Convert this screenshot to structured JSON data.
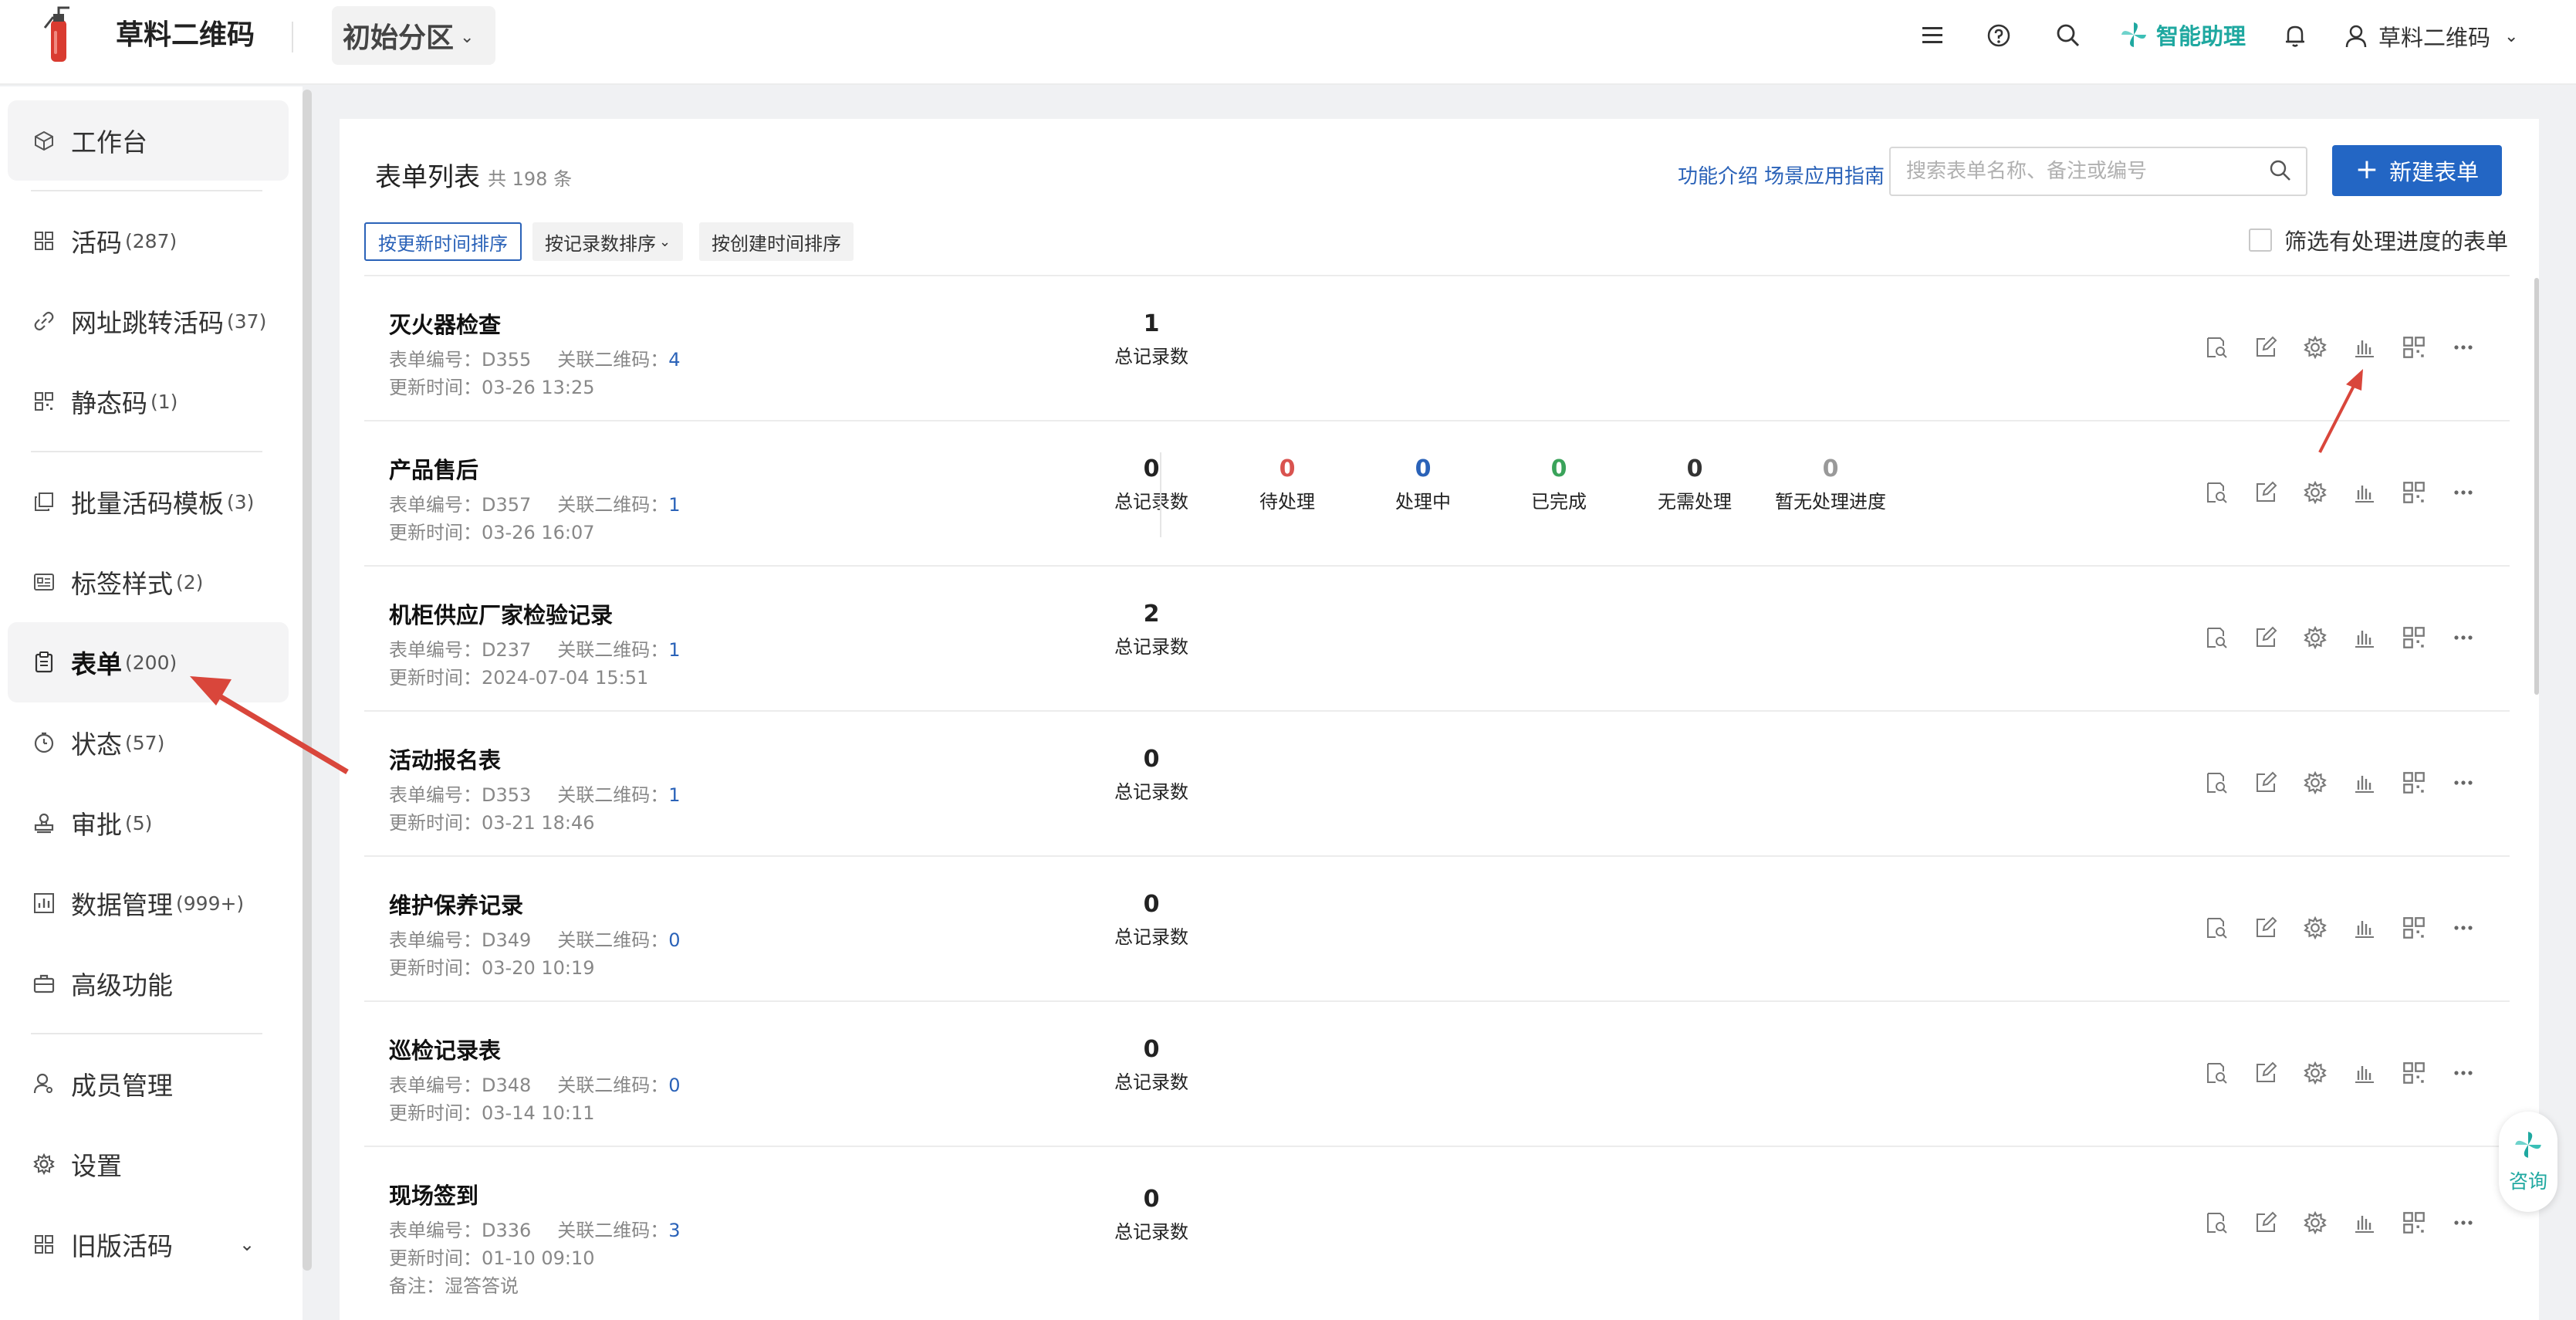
{
  "header": {
    "app_name": "草料二维码",
    "zone": "初始分区",
    "assistant_label": "智能助理",
    "user_name": "草料二维码"
  },
  "sidebar": {
    "items": [
      {
        "label": "工作台",
        "count": ""
      },
      {
        "label": "活码",
        "count": "(287)"
      },
      {
        "label": "网址跳转活码",
        "count": "(37)"
      },
      {
        "label": "静态码",
        "count": "(1)"
      },
      {
        "label": "批量活码模板",
        "count": "(3)"
      },
      {
        "label": "标签样式",
        "count": "(2)"
      },
      {
        "label": "表单",
        "count": "(200)"
      },
      {
        "label": "状态",
        "count": "(57)"
      },
      {
        "label": "审批",
        "count": "(5)"
      },
      {
        "label": "数据管理",
        "count": "(999+)"
      },
      {
        "label": "高级功能",
        "count": ""
      },
      {
        "label": "成员管理",
        "count": ""
      },
      {
        "label": "设置",
        "count": ""
      },
      {
        "label": "旧版活码",
        "count": ""
      }
    ],
    "active_item": "表单"
  },
  "main": {
    "title": "表单列表",
    "total": "共 198 条",
    "links": {
      "intro": "功能介绍",
      "guide": "场景应用指南"
    },
    "search_placeholder": "搜索表单名称、备注或编号",
    "new_button": "新建表单",
    "sort": {
      "by_update": "按更新时间排序",
      "by_records": "按记录数排序",
      "by_create": "按创建时间排序"
    },
    "filter_label": "筛选有处理进度的表单",
    "labels": {
      "form_no": "表单编号：",
      "qr": "关联二维码：",
      "updated": "更新时间：",
      "note": "备注：",
      "total_records": "总记录数"
    },
    "status_labels": {
      "pending": "待处理",
      "processing": "处理中",
      "done": "已完成",
      "no_need": "无需处理",
      "none": "暂无处理进度"
    },
    "status_colors": {
      "pending": "#d9534f",
      "processing": "#2a62b8",
      "done": "#3aa35a",
      "no_need": "#333333",
      "none": "#999999"
    },
    "rows": [
      {
        "title": "灭火器检查",
        "code": "D355",
        "qr": "4",
        "updated": "03-26 13:25",
        "total": "1",
        "note": ""
      },
      {
        "title": "产品售后",
        "code": "D357",
        "qr": "1",
        "updated": "03-26 16:07",
        "total": "0",
        "note": "",
        "status": {
          "pending": "0",
          "processing": "0",
          "done": "0",
          "no_need": "0",
          "none": "0"
        }
      },
      {
        "title": "机柜供应厂家检验记录",
        "code": "D237",
        "qr": "1",
        "updated": "2024-07-04 15:51",
        "total": "2",
        "note": ""
      },
      {
        "title": "活动报名表",
        "code": "D353",
        "qr": "1",
        "updated": "03-21 18:46",
        "total": "0",
        "note": ""
      },
      {
        "title": "维护保养记录",
        "code": "D349",
        "qr": "0",
        "updated": "03-20 10:19",
        "total": "0",
        "note": ""
      },
      {
        "title": "巡检记录表",
        "code": "D348",
        "qr": "0",
        "updated": "03-14 10:11",
        "total": "0",
        "note": ""
      },
      {
        "title": "现场签到",
        "code": "D336",
        "qr": "3",
        "updated": "01-10 09:10",
        "total": "0",
        "note": "湿答答说"
      }
    ],
    "row_actions": [
      "preview-records-icon",
      "edit-icon",
      "settings-icon",
      "statistics-icon",
      "qrcode-icon",
      "more-icon"
    ]
  },
  "consult_label": "咨询",
  "annotation_color": "#d9463b"
}
